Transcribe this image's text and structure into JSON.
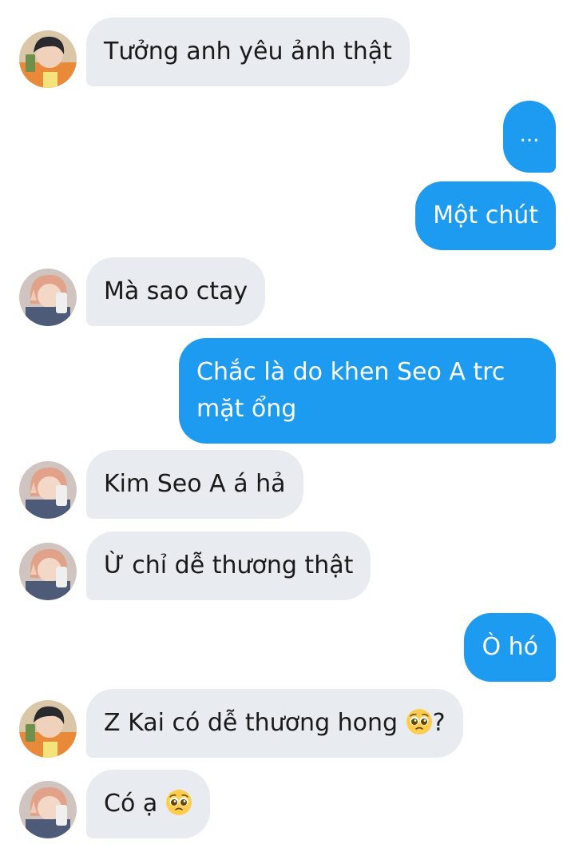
{
  "messages": [
    {
      "text": "Tưởng anh yêu ảnh thật"
    },
    {
      "text": "..."
    },
    {
      "text": "Một chút"
    },
    {
      "text": "Mà sao ctay"
    },
    {
      "line1": "Chắc là do khen Seo A trc",
      "line2": "mặt ổng"
    },
    {
      "text": "Kim Seo A á hả"
    },
    {
      "text": "Ừ chỉ dễ thương thật"
    },
    {
      "text": "Ò hó"
    },
    {
      "text": "Z Kai có dễ thương hong ",
      "suffix": "?",
      "emoji": "pleading-face-emoji"
    },
    {
      "text": "Có ạ ",
      "emoji": "pleading-face-emoji"
    }
  ],
  "colors": {
    "incoming_bubble": "#e8ebef",
    "outgoing_bubble": "#1d9bf0",
    "incoming_text": "#1a1a1a",
    "outgoing_text": "#ffffff"
  }
}
